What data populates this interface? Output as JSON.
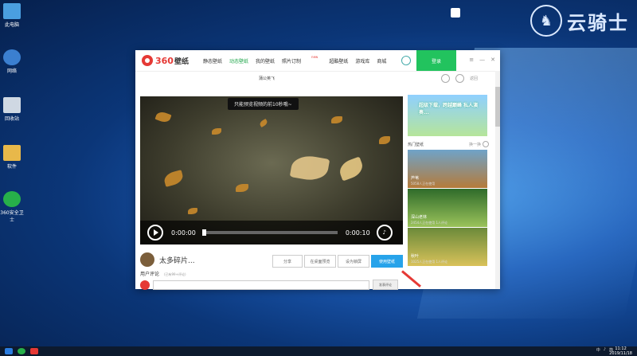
{
  "desktop": {
    "icons": [
      {
        "label": "此电脑",
        "icon": "computer-icon",
        "color": "#4a9fe0"
      },
      {
        "label": "网络",
        "icon": "network-icon",
        "color": "#3b7fd0"
      },
      {
        "label": "回收站",
        "icon": "recycle-bin-icon",
        "color": "#cfd8e3"
      },
      {
        "label": "软件",
        "icon": "folder-icon",
        "color": "#e8b84a"
      },
      {
        "label": "360安全卫士",
        "icon": "360-security-icon",
        "color": "#27b04a"
      }
    ],
    "watermark": "云骑士"
  },
  "app": {
    "logo_text": "360",
    "logo_suffix": "壁纸",
    "nav": [
      {
        "label": "静态壁纸",
        "active": false
      },
      {
        "label": "动态壁纸",
        "active": true
      },
      {
        "label": "我的壁纸",
        "active": false
      },
      {
        "label": "照片订制",
        "active": false,
        "badge": "new"
      },
      {
        "label": "超酷壁纸",
        "active": false
      },
      {
        "label": "游戏库",
        "active": false
      },
      {
        "label": "商城",
        "active": false
      }
    ],
    "login_label": "登录",
    "window_controls": [
      "≡",
      "—",
      "✕"
    ],
    "subbar_center": "蒲公英飞",
    "subbar_back": "返回",
    "video": {
      "tip": "只能预览视频的前10秒哦~",
      "current_time": "0:00:00",
      "duration": "0:00:10",
      "progress": 0
    },
    "video_title": "太多碎片...",
    "actions": {
      "share": "分享",
      "preview": "在桌面预览",
      "set_screensaver": "设为锁屏",
      "use": "使用壁纸"
    },
    "comments": {
      "label": "用户评论",
      "count_note": "(已有99+评论)",
      "submit": "发表评论"
    },
    "sidebar": {
      "banner_text": "超级下载，跨越巅峰 私人演奏...",
      "header": "热门壁纸",
      "more": "换一换",
      "items": [
        {
          "name": "芦苇",
          "meta": "5058人正在使用",
          "color1": "#6fa3c8",
          "color2": "#b57b3a"
        },
        {
          "name": "深山老林",
          "meta": "2454人正在使用  1人评论",
          "color1": "#2f6b2a",
          "color2": "#9bc35a"
        },
        {
          "name": "秋叶",
          "meta": "1025人正在使用  1人评论",
          "color1": "#6b8a3a",
          "color2": "#d9c25a"
        }
      ]
    }
  },
  "taskbar": {
    "tray": [
      "中",
      "♪",
      "简"
    ],
    "time": "11:12",
    "date": "2019/11/18"
  }
}
